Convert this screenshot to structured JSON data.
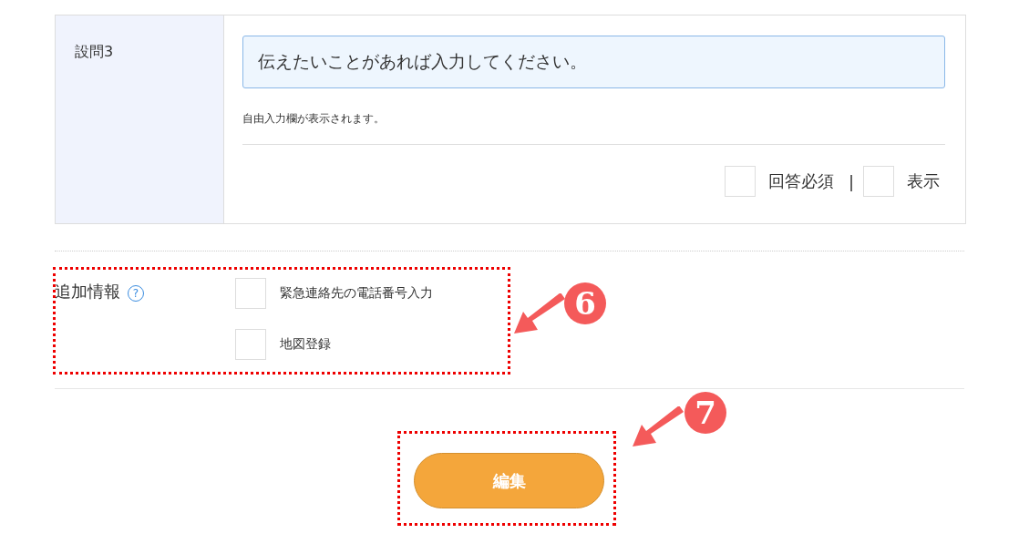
{
  "question": {
    "label": "設問3",
    "input": {
      "value": "伝えたいことがあれば入力してください。"
    },
    "hint": "自由入力欄が表示されます。",
    "options": [
      {
        "label": "回答必須",
        "checked": false
      },
      {
        "label": "表示",
        "checked": false
      }
    ],
    "separator": "|"
  },
  "additional": {
    "label": "追加情報",
    "help": "?",
    "options": [
      {
        "label": "緊急連絡先の電話番号入力",
        "checked": false
      },
      {
        "label": "地図登録",
        "checked": false
      }
    ]
  },
  "edit_button": "編集",
  "callouts": [
    {
      "number": "6"
    },
    {
      "number": "7"
    }
  ]
}
